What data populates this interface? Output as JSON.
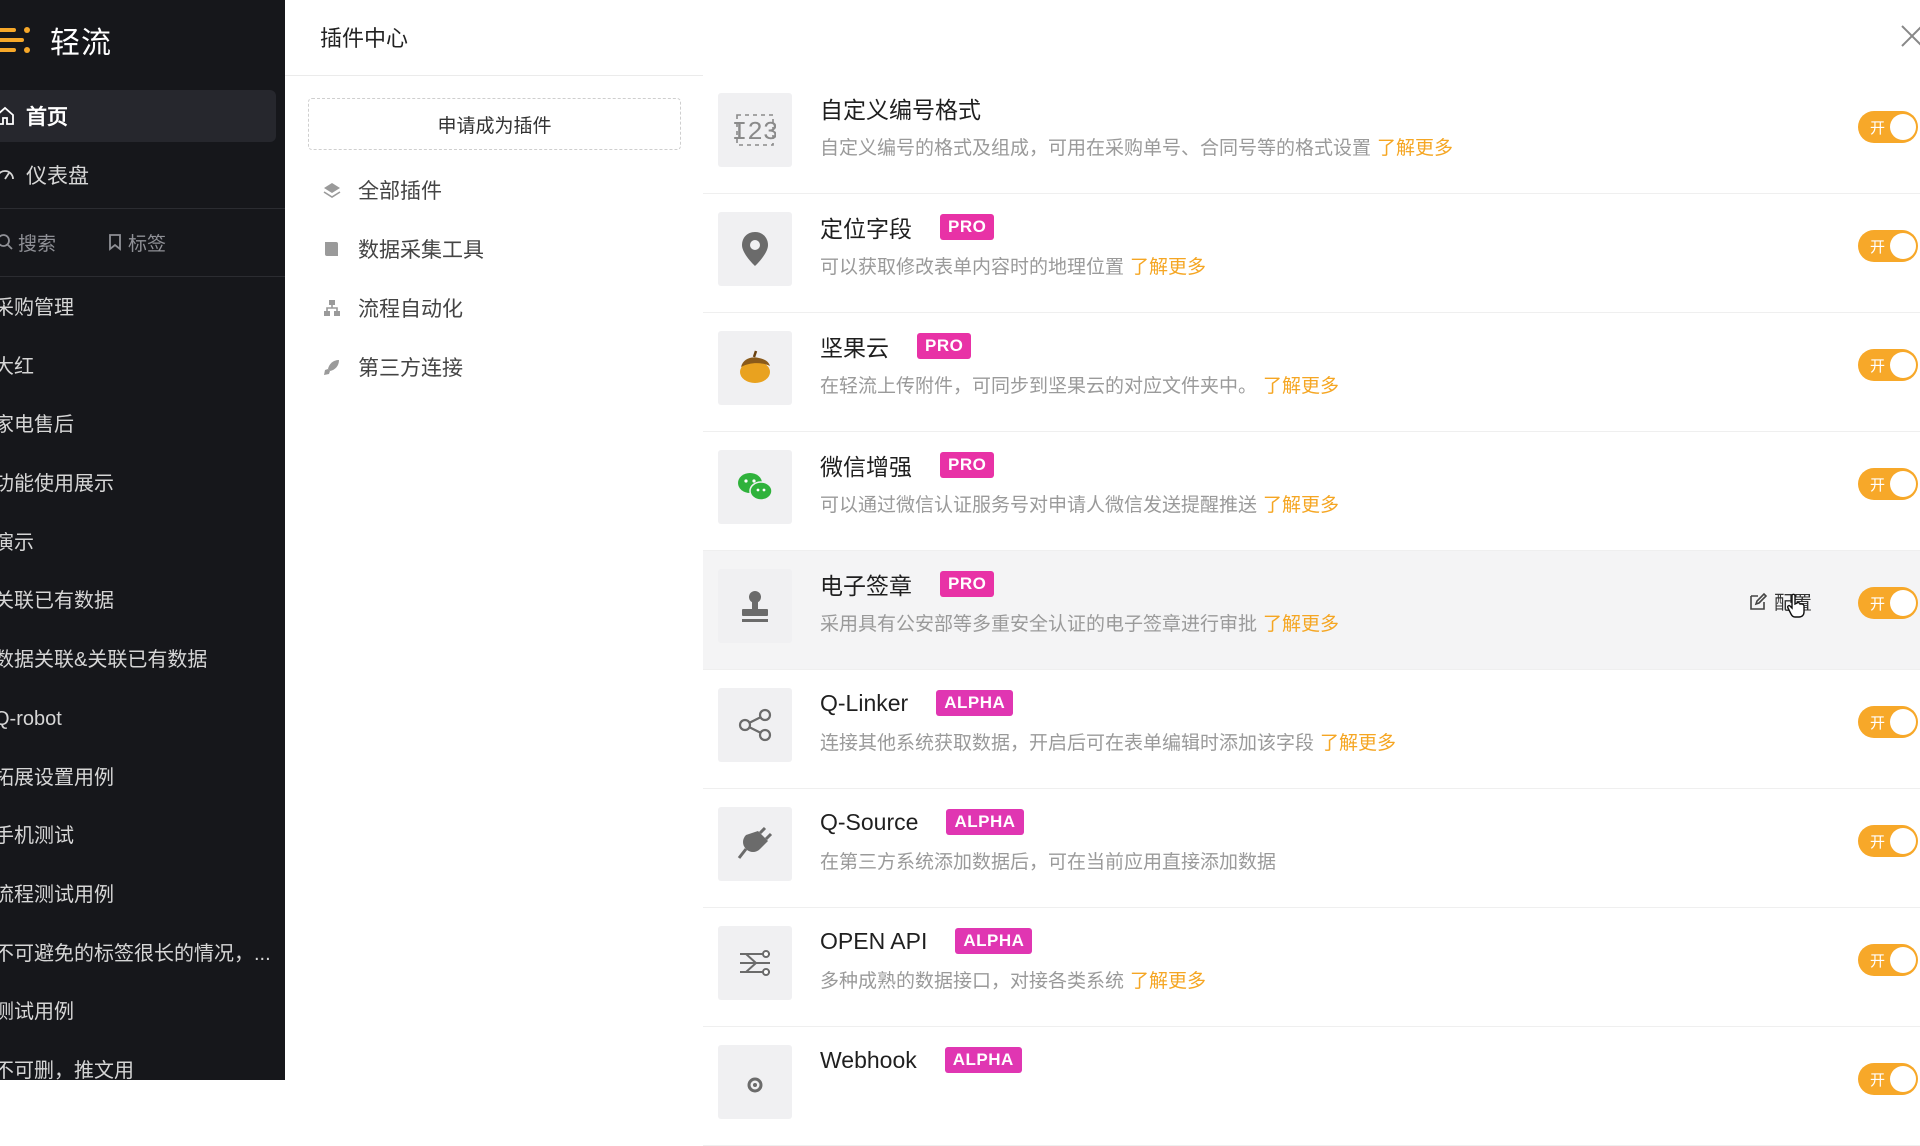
{
  "sidebar": {
    "brand": "轻流",
    "nav": [
      {
        "label": "首页",
        "icon": "home-icon"
      },
      {
        "label": "仪表盘",
        "icon": "dashboard-icon"
      }
    ],
    "tools": [
      {
        "label": "搜索",
        "icon": "search-icon"
      },
      {
        "label": "标签",
        "icon": "bookmark-icon"
      }
    ],
    "apps": [
      "采购管理",
      "大红",
      "家电售后",
      "功能使用展示",
      "演示",
      "关联已有数据",
      "数据关联&关联已有数据",
      "Q-robot",
      "拓展设置用例",
      "手机测试",
      "流程测试用例",
      "不可避免的标签很长的情况，...",
      "测试用例",
      "不可删，推文用"
    ]
  },
  "panel": {
    "title": "插件中心",
    "apply_button": "申请成为插件",
    "categories": [
      {
        "label": "全部插件",
        "icon": "layers-icon"
      },
      {
        "label": "数据采集工具",
        "icon": "book-icon"
      },
      {
        "label": "流程自动化",
        "icon": "sitemap-icon"
      },
      {
        "label": "第三方连接",
        "icon": "rocket-icon"
      }
    ],
    "toggle_label": "开",
    "more_label": "了解更多",
    "config_label": "配置",
    "plugins": [
      {
        "name": "自定义编号格式",
        "badge": "",
        "desc": "自定义编号的格式及组成，可用在采购单号、合同号等的格式设置",
        "more": true,
        "icon": "number-format-icon"
      },
      {
        "name": "定位字段",
        "badge": "PRO",
        "desc": "可以获取修改表单内容时的地理位置",
        "more": true,
        "icon": "location-pin-icon"
      },
      {
        "name": "坚果云",
        "badge": "PRO",
        "desc": "在轻流上传附件，可同步到坚果云的对应文件夹中。",
        "more": true,
        "icon": "nut-cloud-icon"
      },
      {
        "name": "微信增强",
        "badge": "PRO",
        "desc": "可以通过微信认证服务号对申请人微信发送提醒推送",
        "more": true,
        "icon": "wechat-icon"
      },
      {
        "name": "电子签章",
        "badge": "PRO",
        "desc": "采用具有公安部等多重安全认证的电子签章进行审批",
        "more": true,
        "icon": "stamp-icon",
        "hover": true
      },
      {
        "name": "Q-Linker",
        "badge": "ALPHA",
        "desc": "连接其他系统获取数据，开启后可在表单编辑时添加该字段",
        "more": true,
        "icon": "share-nodes-icon"
      },
      {
        "name": "Q-Source",
        "badge": "ALPHA",
        "desc": "在第三方系统添加数据后，可在当前应用直接添加数据",
        "more": false,
        "icon": "plug-icon"
      },
      {
        "name": "OPEN API",
        "badge": "ALPHA",
        "desc": "多种成熟的数据接口，对接各类系统",
        "more": true,
        "icon": "api-icon"
      },
      {
        "name": "Webhook",
        "badge": "ALPHA",
        "desc": "",
        "more": false,
        "icon": "webhook-icon"
      }
    ]
  },
  "colors": {
    "toggle_on": "#f7a829",
    "badge": "#e832a6",
    "link": "#f5a623",
    "sidebar_bg": "#16171b"
  }
}
